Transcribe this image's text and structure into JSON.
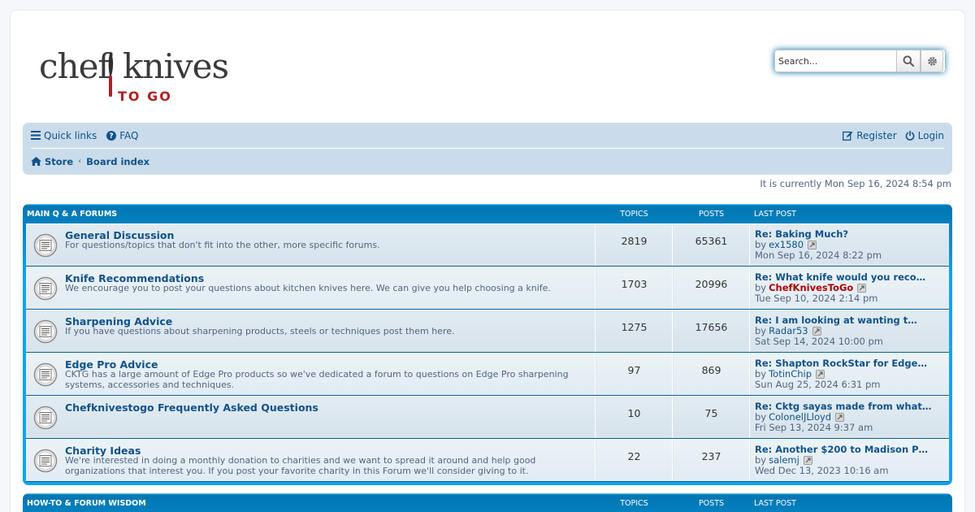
{
  "header": {
    "logo": {
      "word1": "chef",
      "word2": "knives",
      "tagline": "TO GO"
    },
    "search": {
      "placeholder": "Search...",
      "search_icon": "magnifier-icon",
      "advanced_icon": "gear-icon"
    }
  },
  "nav": {
    "quick_links": "Quick links",
    "faq": "FAQ",
    "register": "Register",
    "login": "Login",
    "breadcrumbs": [
      "Store",
      "Board index"
    ]
  },
  "current_time": "It is currently Mon Sep 16, 2024 8:54 pm",
  "columns": {
    "topics": "TOPICS",
    "posts": "POSTS",
    "last_post": "LAST POST"
  },
  "categories": [
    {
      "name": "MAIN Q & A FORUMS",
      "forums": [
        {
          "title": "General Discussion",
          "desc": "For questions/topics that don't fit into the other, more specific forums.",
          "topics": "2819",
          "posts": "65361",
          "last": {
            "title": "Re: Baking Much?",
            "by": "by",
            "author": "ex1580",
            "admin": false,
            "date": "Mon Sep 16, 2024 8:22 pm"
          }
        },
        {
          "title": "Knife Recommendations",
          "desc": "We encourage you to post your questions about kitchen knives here. We can give you help choosing a knife.",
          "topics": "1703",
          "posts": "20996",
          "last": {
            "title": "Re: What knife would you reco…",
            "by": "by",
            "author": "ChefKnivesToGo",
            "admin": true,
            "date": "Tue Sep 10, 2024 2:14 pm"
          }
        },
        {
          "title": "Sharpening Advice",
          "desc": "If you have questions about sharpening products, steels or techniques post them here.",
          "topics": "1275",
          "posts": "17656",
          "last": {
            "title": "Re: I am looking at wanting t…",
            "by": "by",
            "author": "Radar53",
            "admin": false,
            "date": "Sat Sep 14, 2024 10:00 pm"
          }
        },
        {
          "title": "Edge Pro Advice",
          "desc": "CKTG has a large amount of Edge Pro products so we've dedicated a forum to questions on Edge Pro sharpening systems, accessories and techniques.",
          "topics": "97",
          "posts": "869",
          "last": {
            "title": "Re: Shapton RockStar for Edge…",
            "by": "by",
            "author": "TotinChip",
            "admin": false,
            "date": "Sun Aug 25, 2024 6:31 pm"
          }
        },
        {
          "title": "Chefknivestogo Frequently Asked Questions",
          "desc": "",
          "topics": "10",
          "posts": "75",
          "last": {
            "title": "Re: Cktg sayas made from what…",
            "by": "by",
            "author": "ColonelJLloyd",
            "admin": false,
            "date": "Fri Sep 13, 2024 9:37 am"
          }
        },
        {
          "title": "Charity Ideas",
          "desc": "We're interested in doing a monthly donation to charities and we want to spread it around and help good organizations that interest you. If you post your favorite charity in this Forum we'll consider giving to it.",
          "topics": "22",
          "posts": "237",
          "last": {
            "title": "Re: Another $200 to Madison P…",
            "by": "by",
            "author": "salemj",
            "admin": false,
            "date": "Wed Dec 13, 2023 10:16 am"
          }
        }
      ]
    },
    {
      "name": "HOW-TO & FORUM WISDOM",
      "forums": []
    }
  ],
  "colors": {
    "link": "#105289",
    "admin": "#aa0000",
    "category_header": "#0076b1",
    "navbar": "#cadceb"
  }
}
